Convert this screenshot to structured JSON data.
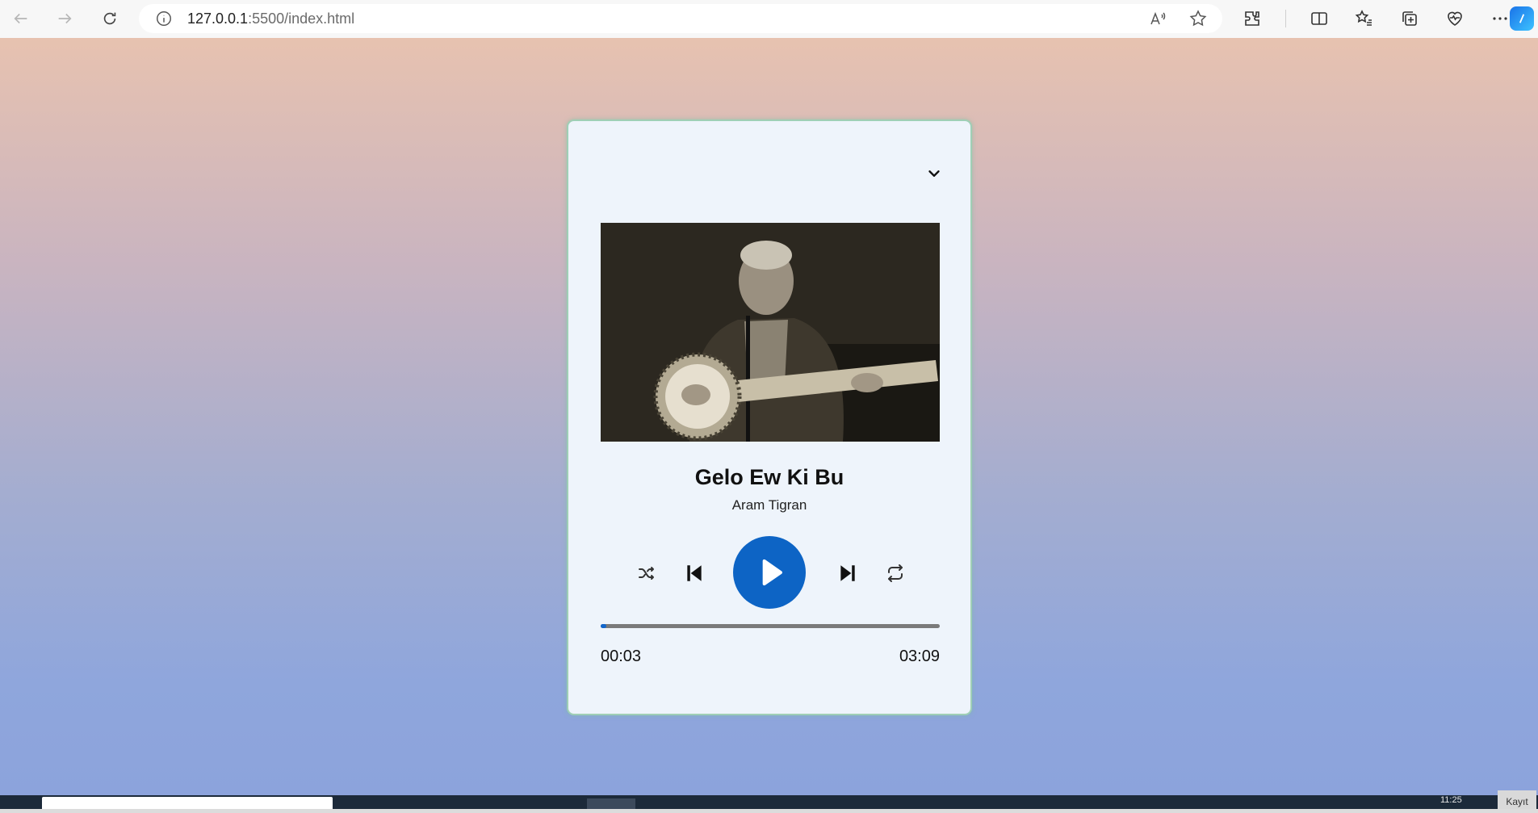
{
  "browser": {
    "url_host": "127.0.0.1",
    "url_rest": ":5500/index.html"
  },
  "player": {
    "title": "Gelo Ew Ki Bu",
    "artist": "Aram Tigran",
    "current_time": "00:03",
    "duration": "03:09",
    "progress_fraction": 0.016,
    "accent_color": "#0d64c5",
    "icons": {
      "collapse": "chevron-down-icon",
      "shuffle": "shuffle-icon",
      "prev": "skip-previous-icon",
      "play": "play-icon",
      "next": "skip-next-icon",
      "repeat": "repeat-icon"
    }
  },
  "taskbar": {
    "clock": "11:25",
    "kayit": "Kayıt"
  }
}
